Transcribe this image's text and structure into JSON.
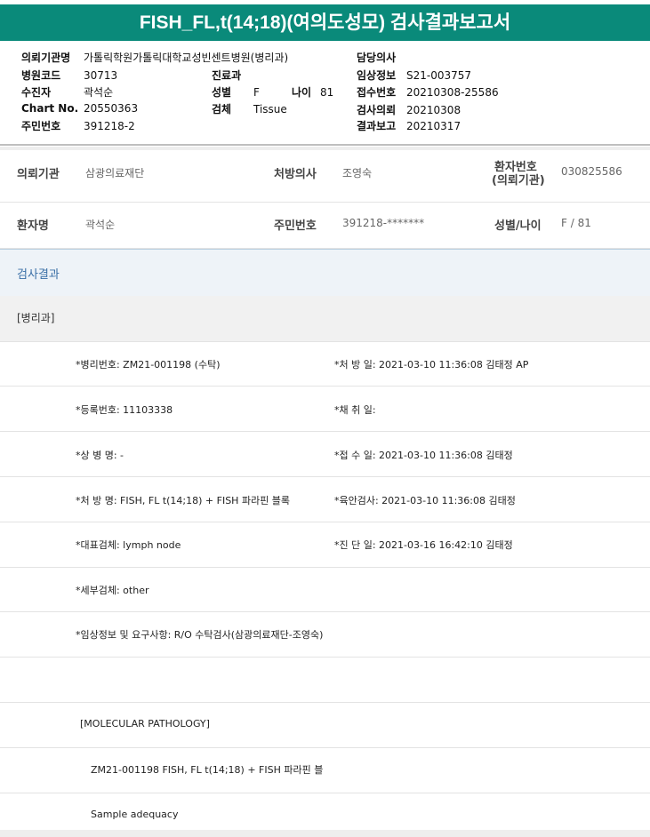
{
  "title": "FISH_FL,t(14;18)(여의도성모) 검사결과보고서",
  "header": {
    "left": [
      {
        "label": "의뢰기관명",
        "value": "가톨릭학원가톨릭대학교성빈센트병원(병리과)"
      },
      {
        "label": "병원코드",
        "value": "30713"
      },
      {
        "label": "수진자",
        "value": "곽석순"
      },
      {
        "label": "Chart No.",
        "value": "20550363"
      },
      {
        "label": "주민번호",
        "value": "391218-2"
      }
    ],
    "middle": {
      "dept_label": "진료과",
      "sex_label": "성별",
      "sex_value": "F",
      "age_label": "나이",
      "age_value": "81",
      "specimen_label": "검체",
      "specimen_value": "Tissue"
    },
    "right": [
      {
        "label": "담당의사",
        "value": ""
      },
      {
        "label": "임상정보",
        "value": "S21-003757"
      },
      {
        "label": "접수번호",
        "value": "20210308-25586"
      },
      {
        "label": "검사의뢰",
        "value": "20210308"
      },
      {
        "label": "결과보고",
        "value": "20210317"
      }
    ]
  },
  "info": {
    "institution_label": "의뢰기관",
    "institution_value": "삼광의료재단",
    "doctor_label": "처방의사",
    "doctor_value": "조영숙",
    "patient_no_label1": "환자번호",
    "patient_no_label2": "(의뢰기관)",
    "patient_no_value": "030825586",
    "patient_label": "환자명",
    "patient_value": "곽석순",
    "ssn_label": "주민번호",
    "ssn_value": "391218-*******",
    "sexage_label": "성별/나이",
    "sexage_value": "F / 81"
  },
  "results": {
    "section_title": "검사결과",
    "subsection": "[병리과]",
    "rows": [
      {
        "left": "*병리번호: ZM21-001198 (수탁)",
        "right": "*처 방 일: 2021-03-10 11:36:08  김태정 AP"
      },
      {
        "left": "*등록번호: 11103338",
        "right": "*채 취 일:"
      },
      {
        "left": "*상 병 명: -",
        "right": "*접 수 일: 2021-03-10 11:36:08  김태정"
      },
      {
        "left": "*처 방 명: FISH, FL t(14;18) + FISH 파라핀 블록",
        "right": "*육안검사: 2021-03-10 11:36:08  김태정"
      },
      {
        "left": "*대표검체: lymph node",
        "right": "*진 단 일: 2021-03-16 16:42:10  김태정"
      },
      {
        "left": "*세부검체: other",
        "right": ""
      },
      {
        "left": "*임상정보 및 요구사항: R/O 수탁검사(삼광의료재단-조영숙)",
        "right": ""
      }
    ],
    "molecular_header": "[MOLECULAR PATHOLOGY]",
    "molecular_line": "ZM21-001198     FISH, FL t(14;18) + FISH 파라핀 블",
    "sample_line": "Sample adequacy"
  }
}
